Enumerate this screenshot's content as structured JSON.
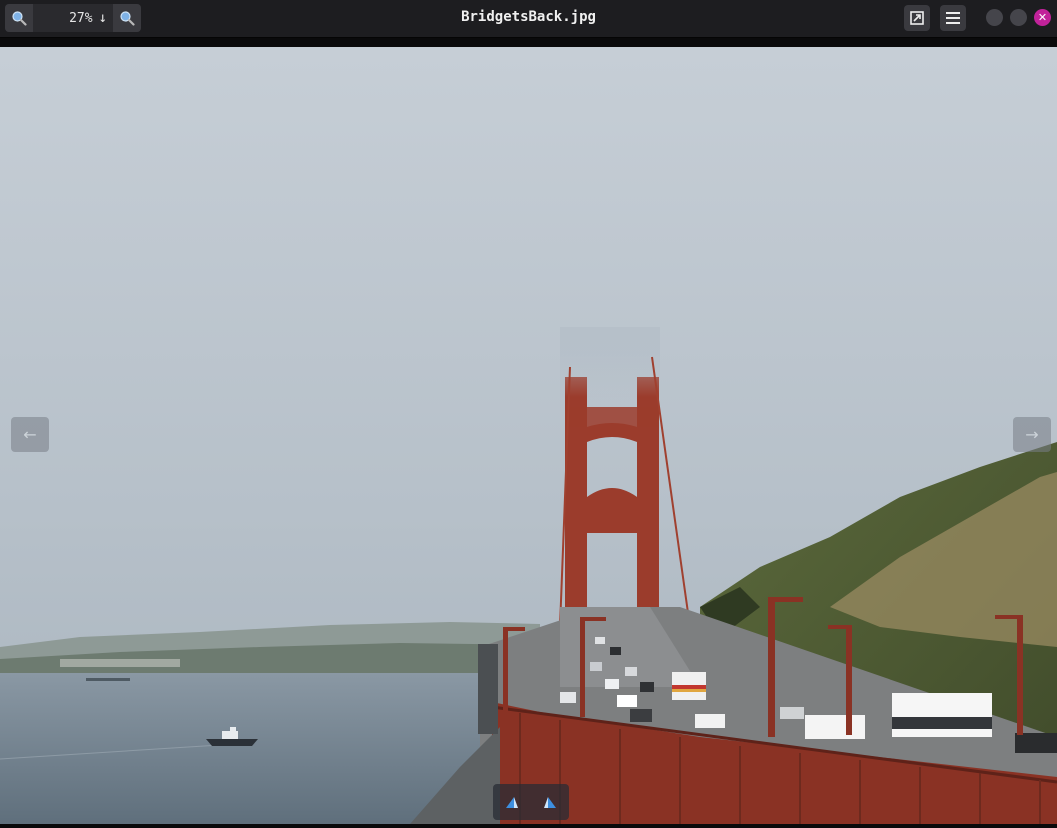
{
  "window": {
    "title": "BridgetsBack.jpg"
  },
  "toolbar": {
    "zoom_value": "27%",
    "zoom_dropdown_icon": "arrow-down-icon",
    "zoom_out_icon": "zoom-out-icon",
    "zoom_in_icon": "zoom-in-icon",
    "open_external_icon": "open-external-icon",
    "menu_icon": "hamburger-menu-icon"
  },
  "window_controls": {
    "minimize_icon": "minimize-icon",
    "maximize_icon": "maximize-icon",
    "close_icon": "close-icon",
    "close_glyph": "✕",
    "close_color": "#c1229a"
  },
  "navigation": {
    "prev_icon": "arrow-left-icon",
    "next_icon": "arrow-right-icon",
    "prev_glyph": "←",
    "next_glyph": "→"
  },
  "rotate": {
    "rotate_left_icon": "rotate-left-icon",
    "rotate_right_icon": "rotate-right-icon"
  },
  "colors": {
    "header_bg": "#1d1d20",
    "accent": "#c1229a",
    "sky": "#b8c3cc",
    "bridge": "#9e3a2a",
    "water": "#6f7f8d",
    "hill": "#5a6a3a"
  }
}
